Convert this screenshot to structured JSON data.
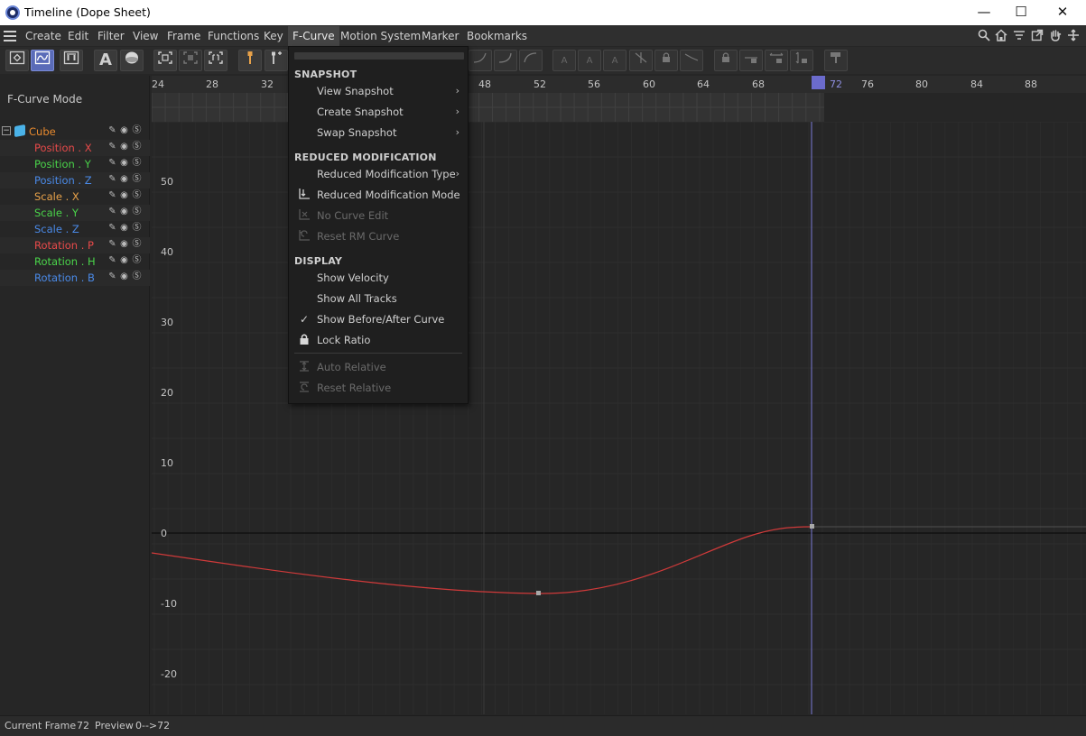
{
  "window": {
    "title": "Timeline (Dope Sheet)",
    "controls": {
      "minimize": "—",
      "maximize": "☐",
      "close": "✕"
    }
  },
  "menubar": {
    "items": [
      "Create",
      "Edit",
      "Filter",
      "View",
      "Frame",
      "Functions",
      "Key",
      "F-Curve",
      "Motion System",
      "Marker",
      "Bookmarks"
    ],
    "active": "F-Curve",
    "right_icons": [
      "search-icon",
      "home-icon",
      "filter-icon",
      "popout-icon",
      "hand-icon",
      "move-icon"
    ]
  },
  "left_panel": {
    "mode_label": "F-Curve Mode",
    "object": {
      "name": "Cube",
      "color": "#e88a2e"
    },
    "tracks": [
      {
        "label": "Position . X",
        "color": "#e84a4a"
      },
      {
        "label": "Position . Y",
        "color": "#4ad44a"
      },
      {
        "label": "Position . Z",
        "color": "#4a8ae8"
      },
      {
        "label": "Scale . X",
        "color": "#e8a24a"
      },
      {
        "label": "Scale . Y",
        "color": "#4ad44a"
      },
      {
        "label": "Scale . Z",
        "color": "#4a8ae8"
      },
      {
        "label": "Rotation . P",
        "color": "#e84a4a"
      },
      {
        "label": "Rotation . H",
        "color": "#4ad44a"
      },
      {
        "label": "Rotation . B",
        "color": "#4a8ae8"
      }
    ]
  },
  "ruler": {
    "ticks_left": [
      "24",
      "28",
      "32"
    ],
    "ticks_right": [
      "48",
      "52",
      "56",
      "60",
      "64",
      "68",
      "72",
      "76",
      "80",
      "84",
      "88"
    ],
    "current": "72"
  },
  "graph": {
    "y_labels": [
      "50",
      "40",
      "30",
      "20",
      "10",
      "0",
      "-10",
      "-20"
    ],
    "curve_color": "#d03a3a",
    "playhead_color": "#7a7ad6"
  },
  "dropdown": {
    "sections": {
      "snapshot": "SNAPSHOT",
      "reduced": "REDUCED MODIFICATION",
      "display": "DISPLAY"
    },
    "items": {
      "view_snapshot": "View Snapshot",
      "create_snapshot": "Create Snapshot",
      "swap_snapshot": "Swap Snapshot",
      "rm_type": "Reduced Modification Type",
      "rm_mode": "Reduced Modification Mode",
      "no_curve_edit": "No Curve Edit",
      "reset_rm": "Reset RM Curve",
      "show_velocity": "Show Velocity",
      "show_all_tracks": "Show All Tracks",
      "show_before_after": "Show Before/After Curve",
      "lock_ratio": "Lock Ratio",
      "auto_relative": "Auto Relative",
      "reset_relative": "Reset Relative"
    }
  },
  "status": {
    "current_frame_label": "Current Frame",
    "current_frame_value": "72",
    "preview_label": "Preview",
    "preview_value": "0-->72"
  }
}
